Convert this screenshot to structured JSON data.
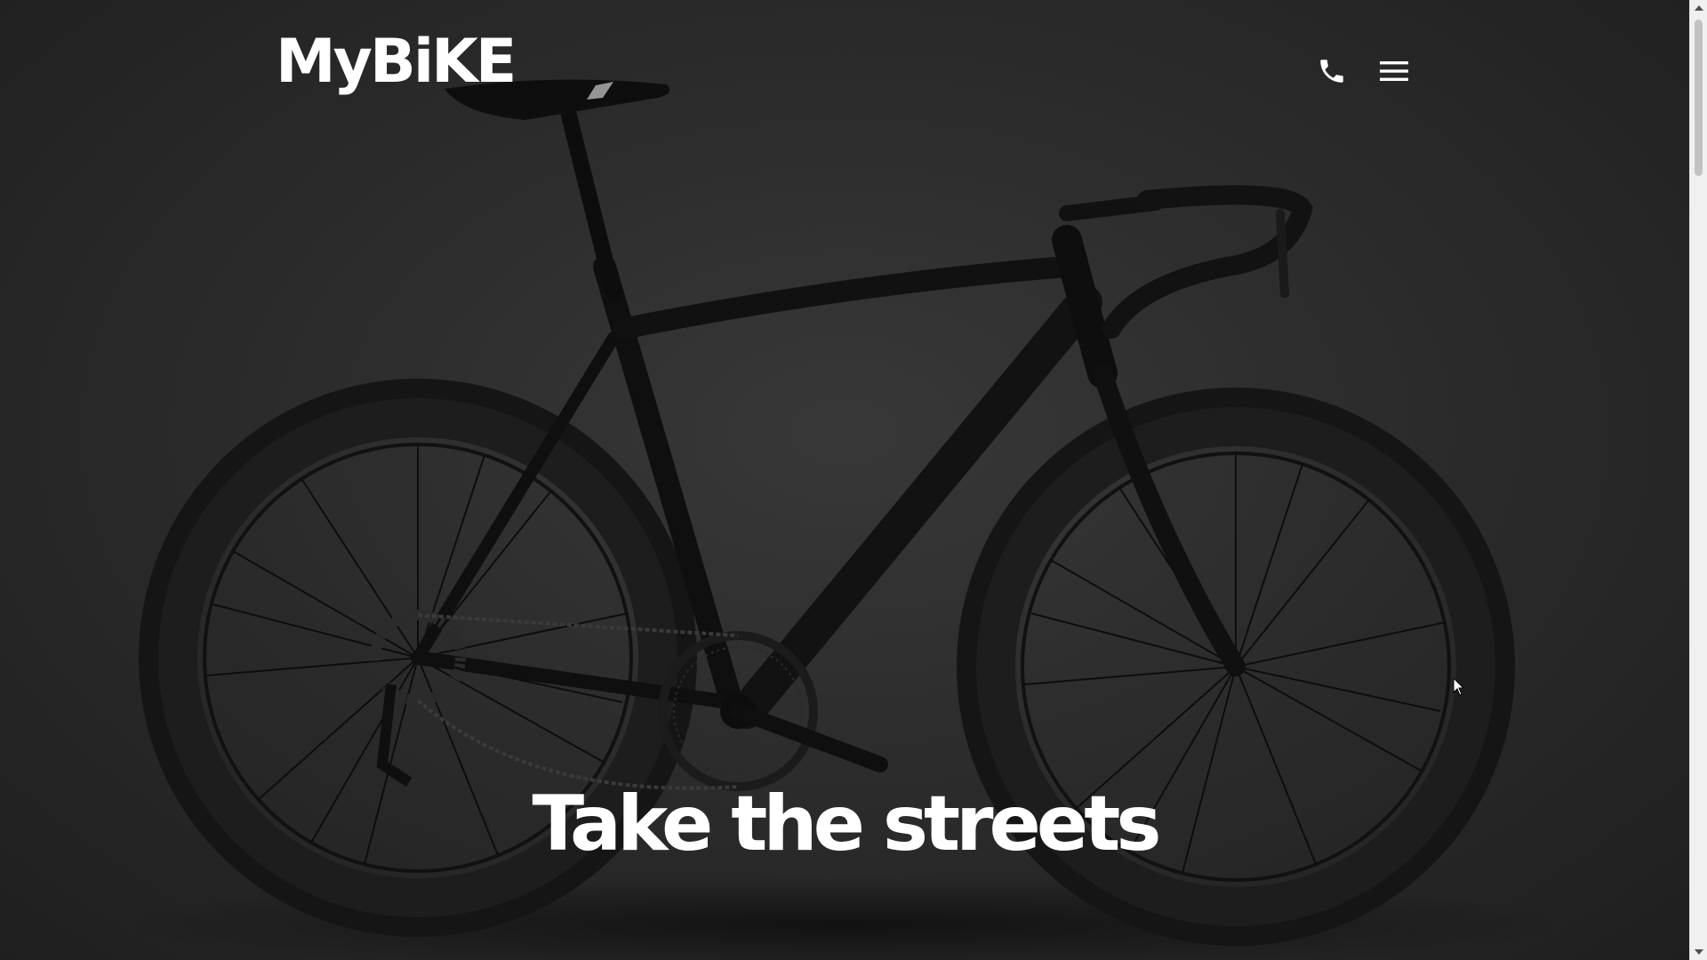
{
  "header": {
    "logo_text": "MyBiKE",
    "phone_icon": "phone-icon",
    "menu_icon": "hamburger-menu-icon"
  },
  "hero": {
    "title": "Take the streets",
    "background_image": "black-road-bike-photo"
  },
  "colors": {
    "background": "#2a2a2a",
    "text": "#ffffff",
    "scrollbar_track": "#f0f0f0",
    "scrollbar_thumb": "#c2c2c2"
  }
}
